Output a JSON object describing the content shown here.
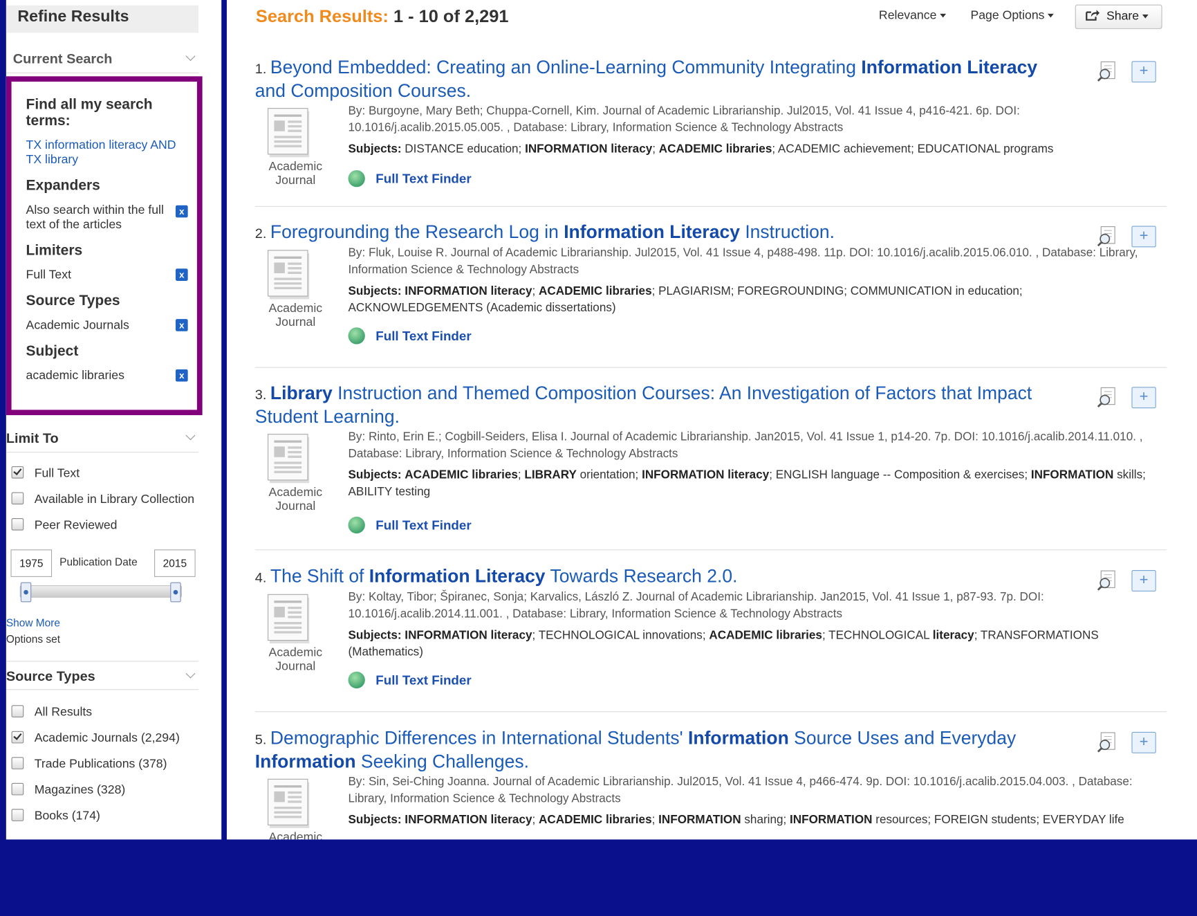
{
  "sidebar": {
    "refine_title": "Refine Results",
    "current_search": {
      "heading": "Current Search",
      "find_all_label": "Find all my search terms:",
      "query": "TX information literacy AND TX library",
      "expanders_label": "Expanders",
      "expander_value": "Also search within the full text of the articles",
      "limiters_label": "Limiters",
      "limiter_value": "Full Text",
      "source_types_label": "Source Types",
      "source_type_value": "Academic Journals",
      "subject_label": "Subject",
      "subject_value": "academic libraries",
      "remove_glyph": "x"
    },
    "limit_to": {
      "heading": "Limit To",
      "options": [
        {
          "label": "Full Text",
          "checked": true
        },
        {
          "label": "Available in Library Collection",
          "checked": false
        },
        {
          "label": "Peer Reviewed",
          "checked": false
        }
      ],
      "date_from": "1975",
      "date_label": "Publication Date",
      "date_to": "2015",
      "show_more": "Show More",
      "options_set": "Options set"
    },
    "source_types": {
      "heading": "Source Types",
      "options": [
        {
          "label": "All Results",
          "checked": false
        },
        {
          "label": "Academic Journals (2,294)",
          "checked": true
        },
        {
          "label": "Trade Publications (378)",
          "checked": false
        },
        {
          "label": "Magazines (328)",
          "checked": false
        },
        {
          "label": "Books (174)",
          "checked": false
        }
      ]
    }
  },
  "main": {
    "header_label": "Search Results:",
    "header_count": "1 - 10 of 2,291",
    "relevance": "Relevance",
    "page_options": "Page Options",
    "share": "Share",
    "full_text_finder": "Full Text Finder",
    "type_line1": "Academic",
    "type_line2": "Journal",
    "subjects_label": "Subjects:",
    "results": [
      {
        "num": "1.",
        "title_html": "Beyond Embedded: Creating an Online-Learning Community Integrating <b>Information Literacy</b> and Composition Courses.",
        "byline": "By: Burgoyne, Mary Beth; Chuppa-Cornell, Kim. Journal of Academic Librarianship. Jul2015, Vol. 41 Issue 4, p416-421. 6p. DOI: 10.1016/j.acalib.2015.05.005. , Database: Library, Information Science & Technology Abstracts",
        "subjects_html": "DISTANCE education; <b>INFORMATION literacy</b>; <b>ACADEMIC libraries</b>; ACADEMIC achievement; EDUCATIONAL programs"
      },
      {
        "num": "2.",
        "title_html": "Foregrounding the Research Log in <b>Information Literacy</b> Instruction.",
        "byline": "By: Fluk, Louise R. Journal of Academic Librarianship. Jul2015, Vol. 41 Issue 4, p488-498. 11p. DOI: 10.1016/j.acalib.2015.06.010. , Database: Library, Information Science & Technology Abstracts",
        "subjects_html": "<b>INFORMATION literacy</b>; <b>ACADEMIC libraries</b>; PLAGIARISM; FOREGROUNDING; COMMUNICATION in education; ACKNOWLEDGEMENTS (Academic dissertations)"
      },
      {
        "num": "3.",
        "title_html": "<b>Library</b> Instruction and Themed Composition Courses: An Investigation of Factors that Impact Student Learning.",
        "byline": "By: Rinto, Erin E.; Cogbill-Seiders, Elisa I. Journal of Academic Librarianship. Jan2015, Vol. 41 Issue 1, p14-20. 7p. DOI: 10.1016/j.acalib.2014.11.010. , Database: Library, Information Science & Technology Abstracts",
        "subjects_html": "<b>ACADEMIC libraries</b>; <b>LIBRARY</b> orientation; <b>INFORMATION literacy</b>; ENGLISH language -- Composition & exercises; <b>INFORMATION</b> skills; ABILITY testing"
      },
      {
        "num": "4.",
        "title_html": "The Shift of <b>Information Literacy</b> Towards Research 2.0.",
        "byline": "By: Koltay, Tibor; Špiranec, Sonja; Karvalics, László Z. Journal of Academic Librarianship. Jan2015, Vol. 41 Issue 1, p87-93. 7p. DOI: 10.1016/j.acalib.2014.11.001. , Database: Library, Information Science & Technology Abstracts",
        "subjects_html": "<b>INFORMATION literacy</b>; TECHNOLOGICAL innovations; <b>ACADEMIC libraries</b>; TECHNOLOGICAL <b>literacy</b>; TRANSFORMATIONS (Mathematics)"
      },
      {
        "num": "5.",
        "title_html": "Demographic Differences in International Students' <b>Information</b> Source Uses and Everyday <b>Information</b> Seeking Challenges.",
        "byline": "By: Sin, Sei-Ching Joanna. Journal of Academic Librarianship. Jul2015, Vol. 41 Issue 4, p466-474. 9p. DOI: 10.1016/j.acalib.2015.04.003. , Database: Library, Information Science & Technology Abstracts",
        "subjects_html": "<b>INFORMATION literacy</b>; <b>ACADEMIC libraries</b>; <b>INFORMATION</b> sharing; <b>INFORMATION</b> resources; FOREIGN students; EVERYDAY life"
      }
    ]
  },
  "colors": {
    "background": "#0a0f8c",
    "highlight_border": "#82007c",
    "header_accent": "#f08a1c",
    "link": "#1a5bb8"
  },
  "icons": [
    "chevron-down-icon",
    "remove-x-icon",
    "checkbox-icon",
    "preview-magnifier-icon",
    "add-to-folder-icon",
    "full-text-finder-globe-icon",
    "share-icon",
    "document-thumbnail-icon"
  ]
}
